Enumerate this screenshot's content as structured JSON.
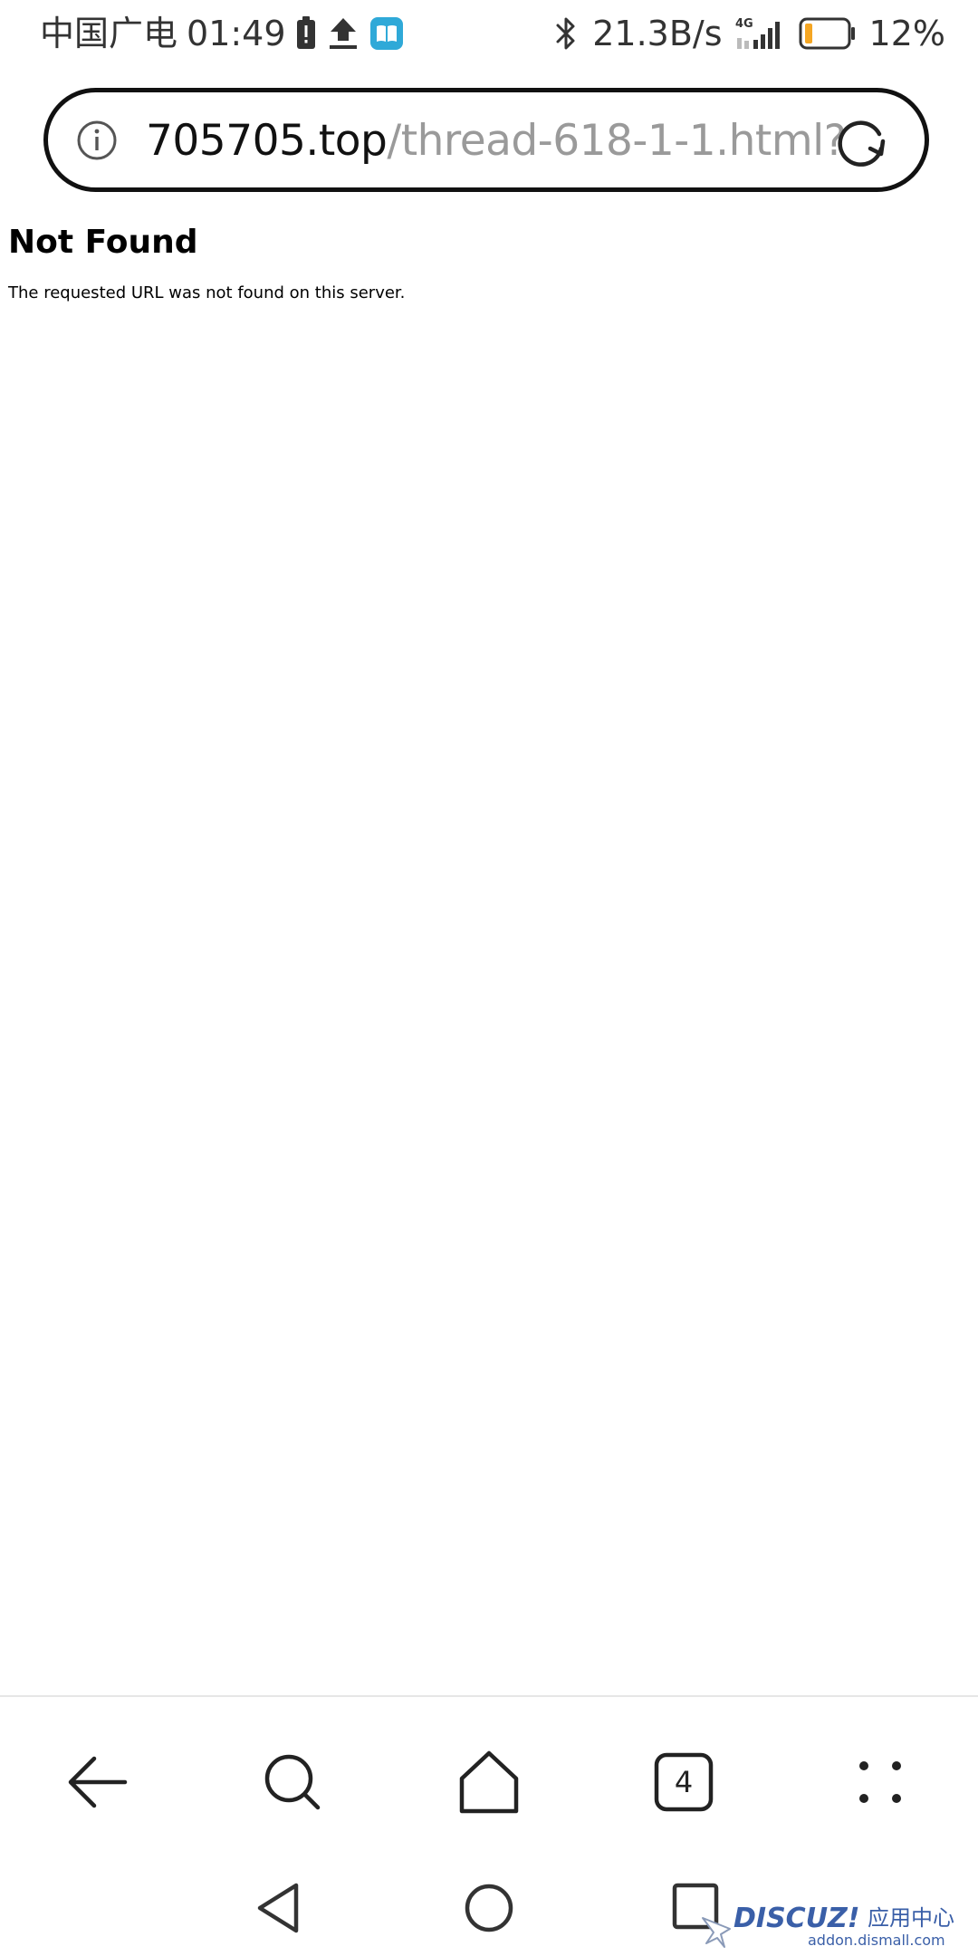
{
  "status_bar": {
    "carrier": "中国广电",
    "time": "01:49",
    "network_speed": "21.3B/s",
    "network_type": "4G",
    "battery": "12%",
    "icons": [
      "battery-alert-icon",
      "upload-icon",
      "book-app-icon",
      "bluetooth-icon",
      "signal-icon",
      "battery-icon"
    ]
  },
  "url_bar": {
    "domain": "705705.top",
    "path": "/thread-618-1-1.html?",
    "info_icon": "info-icon",
    "reload_icon": "reload-icon"
  },
  "page": {
    "heading": "Not Found",
    "message": "The requested URL was not found on this server."
  },
  "toolbar": {
    "tab_count": "4",
    "items": [
      "back-icon",
      "search-icon",
      "home-icon",
      "tabs-icon",
      "menu-icon"
    ]
  },
  "nav_bar": {
    "items": [
      "nav-back-icon",
      "nav-home-icon",
      "nav-recents-icon"
    ]
  },
  "watermark": {
    "brand": "DISCUZ!",
    "subtitle": "应用中心",
    "url": "addon.dismall.com"
  },
  "colors": {
    "battery_low": "#f5a623",
    "app_icon": "#2fa9d8",
    "url_path": "#9a9a9a",
    "watermark": "#3a5fa8"
  }
}
